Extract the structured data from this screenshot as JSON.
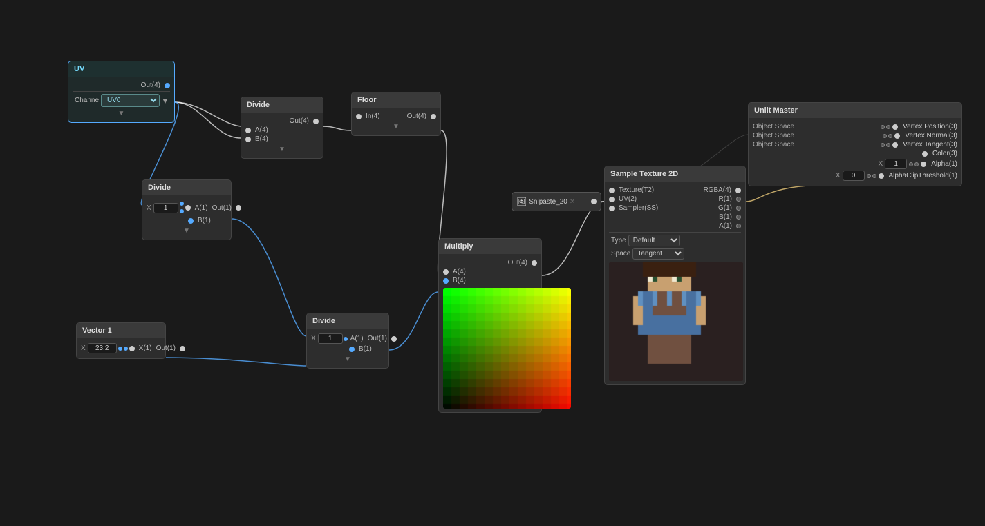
{
  "nodes": {
    "uv": {
      "title": "UV",
      "out_label": "Out(4)",
      "channel_label": "Channe",
      "channel_value": "UV0"
    },
    "divide_top": {
      "title": "Divide",
      "out_label": "Out(4)",
      "a_label": "A(4)",
      "b_label": "B(4)"
    },
    "floor": {
      "title": "Floor",
      "in_label": "In(4)",
      "out_label": "Out(4)"
    },
    "divide_mid": {
      "title": "Divide",
      "x_label": "X",
      "x_value": "1",
      "a_label": "A(1)",
      "b_label": "B(1)",
      "out_label": "Out(1)"
    },
    "vector1": {
      "title": "Vector 1",
      "x_label": "X",
      "x_value": "23.2",
      "x_out_label": "X(1)",
      "out_label": "Out(1)"
    },
    "divide_bot": {
      "title": "Divide",
      "x_label": "X",
      "x_value": "1",
      "a_label": "A(1)",
      "b_label": "B(1)",
      "out_label": "Out(1)"
    },
    "multiply": {
      "title": "Multiply",
      "a_label": "A(4)",
      "b_label": "B(4)",
      "out_label": "Out(4)"
    },
    "snipaste": {
      "title": "Snipaste_20"
    },
    "sample_texture": {
      "title": "Sample Texture 2D",
      "texture_label": "Texture(T2)",
      "uv_label": "UV(2)",
      "sampler_label": "Sampler(SS)",
      "rgba_label": "RGBA(4)",
      "r_label": "R(1)",
      "g_label": "G(1)",
      "b_label": "B(1)",
      "a_label": "A(1)",
      "type_label": "Type",
      "type_value": "Default",
      "space_label": "Space",
      "space_value": "Tangent"
    },
    "unlit_master": {
      "title": "Unlit Master",
      "row1_left": "Object Space",
      "row1_right": "Vertex Position(3)",
      "row2_left": "Object Space",
      "row2_right": "Vertex Normal(3)",
      "row3_left": "Object Space",
      "row3_right": "Vertex Tangent(3)",
      "row4_right": "Color(3)",
      "row5_right": "Alpha(1)",
      "row5_x_label": "X",
      "row5_x_value": "1",
      "row6_right": "AlphaClipThreshold(1)",
      "row6_x_label": "X",
      "row6_x_value": "0"
    }
  }
}
